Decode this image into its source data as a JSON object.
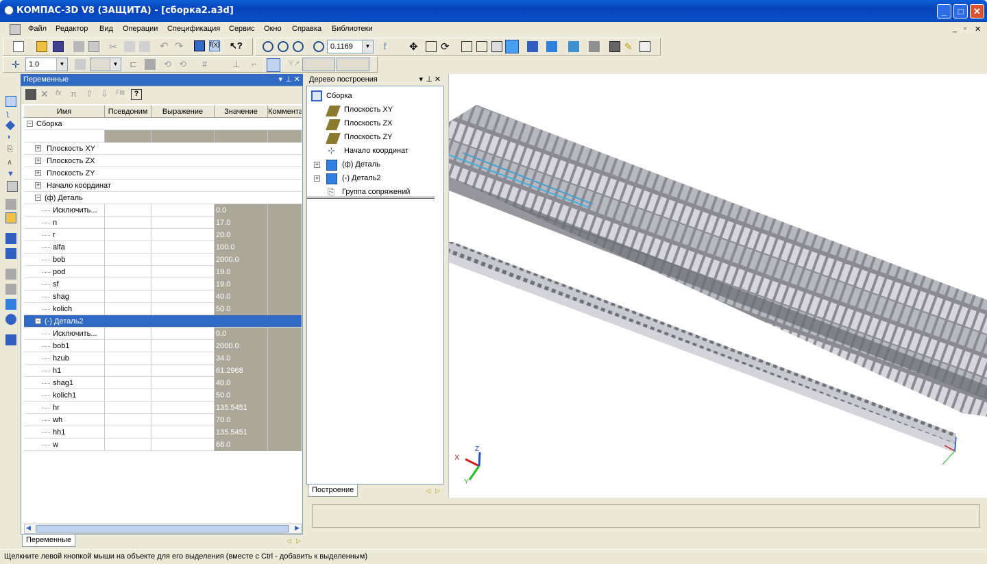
{
  "window": {
    "title": "КОМПАС-3D V8 (ЗАЩИТА) - [сборка2.a3d]"
  },
  "menu": [
    "Файл",
    "Редактор",
    "Вид",
    "Операции",
    "Спецификация",
    "Сервис",
    "Окно",
    "Справка",
    "Библиотеки"
  ],
  "toolbar": {
    "zoom_value": "0.1169",
    "step_value": "1.0"
  },
  "variables_panel": {
    "title": "Переменные",
    "columns": [
      "Имя",
      "Псевдоним",
      "Выражение",
      "Значение",
      "Коммента"
    ],
    "groups": [
      {
        "name": "Сборка",
        "expanded": true
      },
      {
        "name": "Плоскость XY",
        "expanded": false
      },
      {
        "name": "Плоскость ZX",
        "expanded": false
      },
      {
        "name": "Плоскость ZY",
        "expanded": false
      },
      {
        "name": "Начало координат",
        "expanded": false
      }
    ],
    "part1": {
      "name": "(ф) Деталь",
      "rows": [
        {
          "name": "Исключить...",
          "value": "0.0"
        },
        {
          "name": "n",
          "value": "17.0"
        },
        {
          "name": "r",
          "value": "20.0"
        },
        {
          "name": "alfa",
          "value": "100.0"
        },
        {
          "name": "bob",
          "value": "2000.0"
        },
        {
          "name": "pod",
          "value": "19.0"
        },
        {
          "name": "sf",
          "value": "19.0"
        },
        {
          "name": "shag",
          "value": "40.0"
        },
        {
          "name": "kolich",
          "value": "50.0"
        }
      ]
    },
    "part2": {
      "name": "(-) Деталь2",
      "rows": [
        {
          "name": "Исключить...",
          "value": "0.0"
        },
        {
          "name": "bob1",
          "value": "2000.0"
        },
        {
          "name": "hzub",
          "value": "34.0"
        },
        {
          "name": "h1",
          "value": "61.2968"
        },
        {
          "name": "shag1",
          "value": "40.0"
        },
        {
          "name": "kolich1",
          "value": "50.0"
        },
        {
          "name": "hr",
          "value": "135.5451"
        },
        {
          "name": "wh",
          "value": "70.0"
        },
        {
          "name": "hh1",
          "value": "135.5451"
        },
        {
          "name": "w",
          "value": "68.0"
        }
      ]
    },
    "tab": "Переменные"
  },
  "tree_panel": {
    "title": "Дерево построения",
    "root": "Сборка",
    "items": [
      "Плоскость XY",
      "Плоскость ZX",
      "Плоскость ZY",
      "Начало координат",
      "(ф) Деталь",
      "(-) Деталь2",
      "Группа сопряжений"
    ],
    "tab": "Построение"
  },
  "axes": {
    "x": "X",
    "y": "Y",
    "z": "Z"
  },
  "status": "Щелкните левой кнопкой мыши на объекте для его выделения (вместе с Ctrl - добавить к выделенным)",
  "colors": {
    "selection": "#316ac5",
    "titlebar": "#0a50c8",
    "gray_cell": "#aca899"
  }
}
